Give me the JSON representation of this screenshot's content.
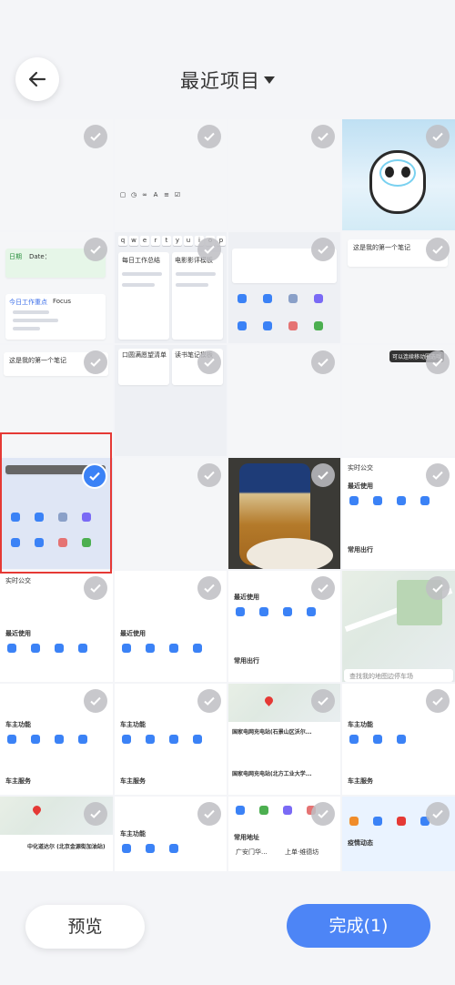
{
  "header": {
    "title": "最近项目",
    "back_icon": "arrow-left-icon",
    "dropdown_icon": "caret-down-icon"
  },
  "grid": {
    "cells": [
      {
        "id": "c00",
        "selected": false
      },
      {
        "id": "c01",
        "selected": false
      },
      {
        "id": "c02",
        "selected": false
      },
      {
        "id": "c03",
        "selected": false
      }
    ],
    "texts": {
      "note1": "这是我的第一个笔记",
      "focus": "今日工作重点",
      "focus2": "Focus",
      "date_label": "日期",
      "date_value": "Date：",
      "daily": "每日工作总结",
      "movie": "电影影评模板",
      "reading": "读书笔记模板",
      "wishlist": "口圆满愿望清单",
      "common_use": "最近使用",
      "common_trip": "常用出行",
      "owner_func": "车主功能",
      "owner_service": "车主服务",
      "search_place": "查找我的地图边停车场",
      "charge1": "国家电网充电站(石景山区沃尔...",
      "charge2": "国家电网充电站(北方工业大学...",
      "station": "中化道达尔 (北京金源街加油站)",
      "common_addr": "常用地址",
      "addr1": "广安门华...",
      "addr2": "上单·维德坊",
      "epidemic": "疫情动态",
      "realtime_bus": "实时公交",
      "tip": "可以连续移动圈选哦"
    }
  },
  "footer": {
    "preview_label": "预览",
    "done_label": "完成(1)"
  },
  "colors": {
    "accent": "#4d85f6",
    "selected_border": "#e53935",
    "check_bg": "#bebec3"
  }
}
